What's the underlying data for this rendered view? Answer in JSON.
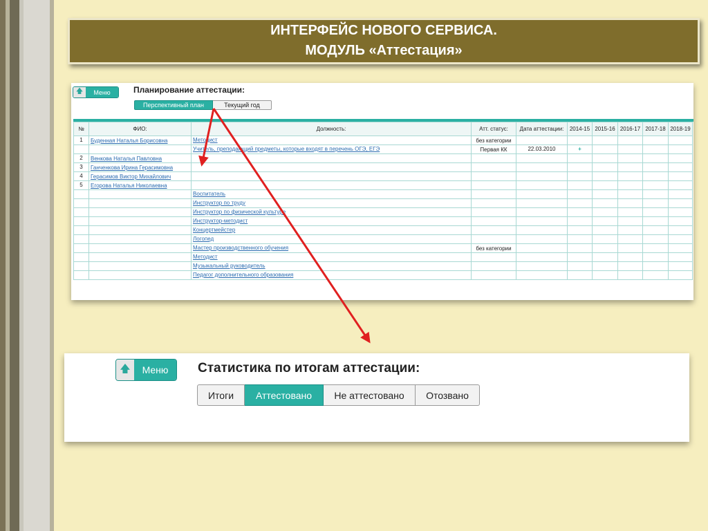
{
  "slide_title": {
    "line1": "ИНТЕРФЕЙС НОВОГО СЕРВИСА.",
    "line2": "МОДУЛЬ «Аттестация»"
  },
  "colors": {
    "title_bg": "#7f6d2c",
    "accent": "#2ab0a3",
    "link": "#2b6cb0",
    "slide_bg": "#f6eebf",
    "arrow": "#e02020"
  },
  "screenshot1": {
    "menu_label": "Меню",
    "heading": "Планирование аттестации:",
    "tabs": [
      {
        "label": "Перспективный план",
        "active": true
      },
      {
        "label": "Текущий год",
        "active": false
      }
    ],
    "columns": [
      "№",
      "ФИО:",
      "Должность:",
      "Атт. статус:",
      "Дата аттестации:",
      "2014-15",
      "2015-16",
      "2016-17",
      "2017-18",
      "2018-19"
    ],
    "rows": [
      {
        "num": "1",
        "name": "Буденная Наталья Борисовна",
        "position": "Методист",
        "status": "без категории",
        "date": "",
        "y2014": ""
      },
      {
        "num": "",
        "name": "",
        "position": "Учитель, преподающий предметы, которые входят в перечень ОГЭ, ЕГЭ",
        "status": "Первая КК",
        "date": "22.03.2010",
        "y2014": "+"
      },
      {
        "num": "2",
        "name": "Венкова Наталья Павловна",
        "position": "",
        "status": "",
        "date": "",
        "y2014": ""
      },
      {
        "num": "3",
        "name": "Ганченкова Ирина Герасимовна",
        "position": "",
        "status": "",
        "date": "",
        "y2014": ""
      },
      {
        "num": "4",
        "name": "Герасимов Виктор Михайлович",
        "position": "",
        "status": "",
        "date": "",
        "y2014": ""
      },
      {
        "num": "5",
        "name": "Егорова Наталья Николаевна",
        "position": "",
        "status": "",
        "date": "",
        "y2014": ""
      },
      {
        "num": "",
        "name": "",
        "position": "Воспитатель",
        "status": "",
        "date": "",
        "y2014": ""
      },
      {
        "num": "",
        "name": "",
        "position": "Инструктор по труду",
        "status": "",
        "date": "",
        "y2014": ""
      },
      {
        "num": "",
        "name": "",
        "position": "Инструктор по физической культуре",
        "status": "",
        "date": "",
        "y2014": ""
      },
      {
        "num": "",
        "name": "",
        "position": "Инструктор-методист",
        "status": "",
        "date": "",
        "y2014": ""
      },
      {
        "num": "",
        "name": "",
        "position": "Концертмейстер",
        "status": "",
        "date": "",
        "y2014": ""
      },
      {
        "num": "",
        "name": "",
        "position": "Логопед",
        "status": "",
        "date": "",
        "y2014": ""
      },
      {
        "num": "",
        "name": "",
        "position": "Мастер производственного обучения",
        "status": "без категории",
        "date": "",
        "y2014": ""
      },
      {
        "num": "",
        "name": "",
        "position": "Методист",
        "status": "",
        "date": "",
        "y2014": ""
      },
      {
        "num": "",
        "name": "",
        "position": "Музыкальный руководитель",
        "status": "",
        "date": "",
        "y2014": ""
      },
      {
        "num": "",
        "name": "",
        "position": "Педагог дополнительного образования",
        "status": "",
        "date": "",
        "y2014": ""
      }
    ]
  },
  "screenshot2": {
    "menu_label": "Меню",
    "heading": "Статистика по итогам аттестации:",
    "tabs": [
      {
        "label": "Итоги",
        "active": false
      },
      {
        "label": "Аттестовано",
        "active": true
      },
      {
        "label": "Не аттестовано",
        "active": false
      },
      {
        "label": "Отозвано",
        "active": false
      }
    ]
  }
}
